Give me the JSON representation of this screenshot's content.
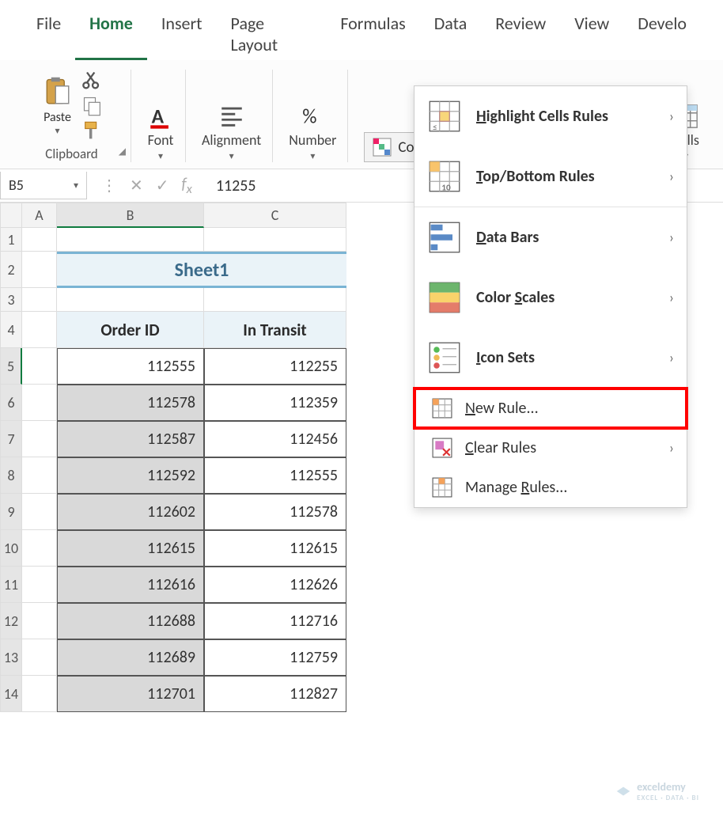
{
  "ribbonTabs": [
    "File",
    "Home",
    "Insert",
    "Page Layout",
    "Formulas",
    "Data",
    "Review",
    "View",
    "Develo"
  ],
  "activeTab": "Home",
  "groups": {
    "clipboard": {
      "paste": "Paste",
      "label": "Clipboard"
    },
    "font": {
      "label": "Font"
    },
    "alignment": {
      "label": "Alignment"
    },
    "number": {
      "label": "Number"
    },
    "cf_button": "Conditional Formatting",
    "cells": {
      "label": "Cells"
    }
  },
  "cf_menu": {
    "highlight": "Highlight Cells Rules",
    "topbottom": "Top/Bottom Rules",
    "databars": "Data Bars",
    "colorscales": "Color Scales",
    "iconsets": "Icon Sets",
    "newrule": "New Rule...",
    "clearrules": "Clear Rules",
    "managerules": "Manage Rules..."
  },
  "nameBox": "B5",
  "formulaValue": "11255",
  "columns": [
    "A",
    "B",
    "C"
  ],
  "rowLabels": [
    "1",
    "2",
    "3",
    "4",
    "5",
    "6",
    "7",
    "8",
    "9",
    "10",
    "11",
    "12",
    "13",
    "14"
  ],
  "sheetTitle": "Sheet1",
  "tableHeaders": {
    "b": "Order ID",
    "c": "In Transit"
  },
  "tableData": [
    {
      "b": "112555",
      "c": "112255"
    },
    {
      "b": "112578",
      "c": "112359"
    },
    {
      "b": "112587",
      "c": "112456"
    },
    {
      "b": "112592",
      "c": "112555"
    },
    {
      "b": "112602",
      "c": "112578"
    },
    {
      "b": "112615",
      "c": "112615"
    },
    {
      "b": "112616",
      "c": "112626"
    },
    {
      "b": "112688",
      "c": "112716"
    },
    {
      "b": "112689",
      "c": "112759"
    },
    {
      "b": "112701",
      "c": "112827"
    }
  ],
  "watermark": {
    "t1": "exceldemy",
    "t2": "EXCEL · DATA · BI"
  }
}
